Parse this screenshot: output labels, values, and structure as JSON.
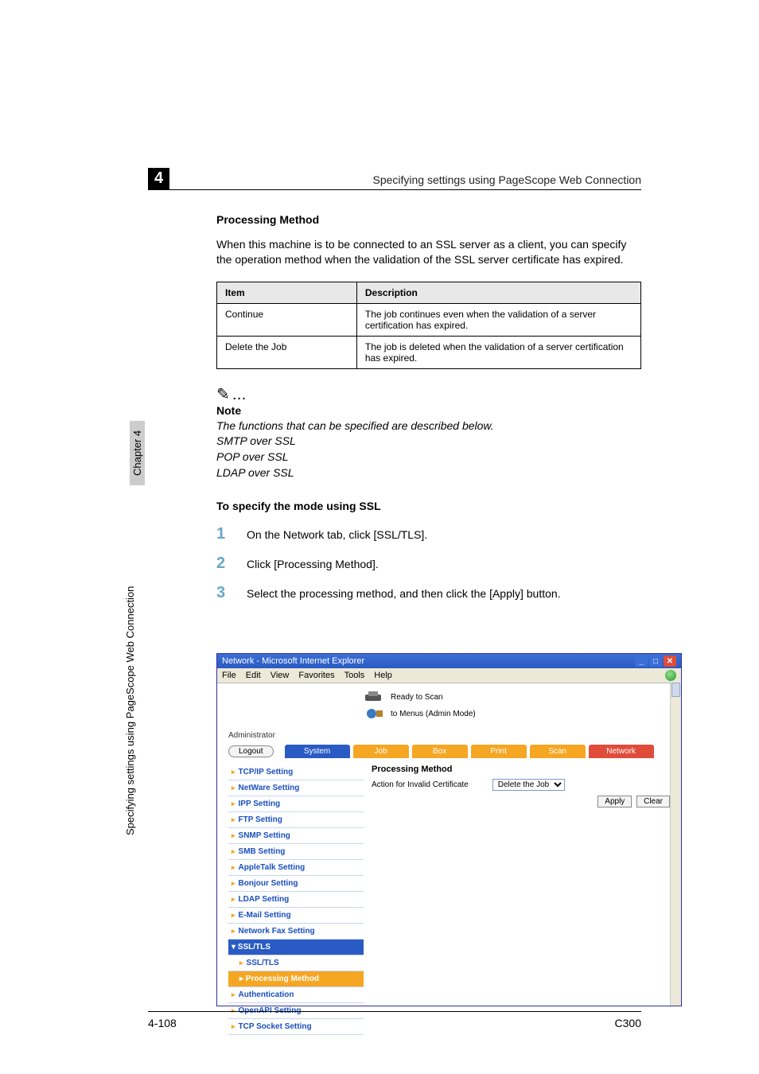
{
  "header": {
    "right": "Specifying settings using PageScope Web Connection",
    "num": "4"
  },
  "h1": "Processing Method",
  "para": "When this machine is to be connected to an SSL server as a client, you can specify the operation method when the validation of the SSL server certificate has expired.",
  "table": {
    "headers": [
      "Item",
      "Description"
    ],
    "rows": [
      [
        "Continue",
        "The job continues even when the validation of a server certification has expired."
      ],
      [
        "Delete the Job",
        "The job is deleted when the validation of a server certification has expired."
      ]
    ]
  },
  "note": {
    "label": "Note",
    "lines": [
      "The functions that can be specified are described below.",
      "SMTP over SSL",
      "POP over SSL",
      "LDAP over SSL"
    ]
  },
  "h2": "To specify the mode using SSL",
  "steps": [
    {
      "n": "1",
      "t": "On the Network tab, click [SSL/TLS]."
    },
    {
      "n": "2",
      "t": "Click [Processing Method]."
    },
    {
      "n": "3",
      "t": "Select the processing method, and then click the [Apply] button."
    }
  ],
  "ss": {
    "title": "Network - Microsoft Internet Explorer",
    "menu": [
      "File",
      "Edit",
      "View",
      "Favorites",
      "Tools",
      "Help"
    ],
    "ready": "Ready to Scan",
    "menus": "to Menus (Admin Mode)",
    "admin": "Administrator",
    "logout": "Logout",
    "tabs": [
      "System",
      "Job",
      "Box",
      "Print",
      "Scan",
      "Network"
    ],
    "side": [
      {
        "t": "TCP/IP Setting"
      },
      {
        "t": "NetWare Setting"
      },
      {
        "t": "IPP Setting"
      },
      {
        "t": "FTP Setting"
      },
      {
        "t": "SNMP Setting"
      },
      {
        "t": "SMB Setting"
      },
      {
        "t": "AppleTalk Setting"
      },
      {
        "t": "Bonjour Setting"
      },
      {
        "t": "LDAP Setting"
      },
      {
        "t": "E-Mail Setting"
      },
      {
        "t": "Network Fax Setting"
      },
      {
        "t": "SSL/TLS",
        "sel": true,
        "open": true
      },
      {
        "t": "SSL/TLS",
        "sub": true
      },
      {
        "t": "Processing Method",
        "sub": true,
        "hl": true
      },
      {
        "t": "Authentication"
      },
      {
        "t": "OpenAPI Setting"
      },
      {
        "t": "TCP Socket Setting"
      }
    ],
    "content": {
      "heading": "Processing Method",
      "row_label": "Action for Invalid Certificate",
      "select_value": "Delete the Job",
      "apply": "Apply",
      "clear": "Clear"
    }
  },
  "side_caption": "Specifying settings using PageScope Web Connection",
  "side_chapter": "Chapter 4",
  "footer": {
    "left": "4-108",
    "right": "C300"
  }
}
